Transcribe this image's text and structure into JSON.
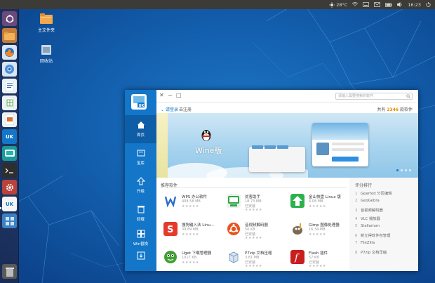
{
  "top_panel": {
    "weather": "28°C",
    "clock": "16:23"
  },
  "desktop": {
    "icons": [
      {
        "label": "主文件夹",
        "icon": "folder-icon"
      },
      {
        "label": "回收站",
        "icon": "trash-icon"
      }
    ]
  },
  "launcher": {
    "items": [
      "dash-home-icon",
      "files-icon",
      "firefox-icon",
      "chromium-icon",
      "writer-icon",
      "calc-icon",
      "impress-icon",
      "ubuntu-kylin-icon",
      "kylin-assistant-icon",
      "terminal-icon",
      "settings-icon",
      "software-center-icon",
      "workspace-icon",
      "trash-icon"
    ],
    "kylin_label": "UK"
  },
  "window": {
    "search_placeholder": "请输入需要搜索的软件",
    "login": "请登录",
    "register": "去注册",
    "count_prefix": "共有",
    "count": "2346",
    "count_suffix": "款软件",
    "nav": [
      {
        "label": "首页",
        "icon": "home-icon"
      },
      {
        "label": "宝库",
        "icon": "treasure-icon"
      },
      {
        "label": "升级",
        "icon": "upgrade-icon"
      },
      {
        "label": "卸载",
        "icon": "uninstall-icon"
      },
      {
        "label": "Win替换",
        "icon": "windows-grid-icon"
      },
      {
        "label": "",
        "icon": "download-task-icon"
      }
    ],
    "banner": {
      "title": "Wine版"
    },
    "recommend_title": "推荐软件",
    "apps": [
      {
        "name": "WPS 办公软件",
        "size": "408.58 MB",
        "stars": "★★★★★"
      },
      {
        "name": "优客助手",
        "size": "18.73 MB",
        "state": "已安装",
        "stars": "★★★★★"
      },
      {
        "name": "金山快盘 Linux 版",
        "size": "6.08 MB",
        "stars": "★★★★★"
      },
      {
        "name": "搜狗输入法 Linu...",
        "size": "39.89 MB",
        "stars": "★★★★★"
      },
      {
        "name": "音视频解码器",
        "size": "50 KB",
        "state": "已安装",
        "stars": "★★★★★"
      },
      {
        "name": "Gimp 图像处理器",
        "size": "16.34 MB",
        "stars": "★★★★★"
      },
      {
        "name": "Uget 下载管理器",
        "size": "1017 KB",
        "stars": "★★★★★"
      },
      {
        "name": "P7zip 文档压缩",
        "size": "3.81 MB",
        "state": "已安装",
        "stars": "★★★★★"
      },
      {
        "name": "Flash 插件",
        "size": "57 KB",
        "state": "已安装",
        "stars": "★★★★★"
      }
    ],
    "ranking_title": "评分排行",
    "ranking": [
      "Gparted 分区编辑",
      "GeoGebra",
      "音视频解码器",
      "VLC 播放器",
      "Stellarium",
      "新立得软件包管理",
      "FileZilla",
      "P7zip 文档压缩"
    ]
  }
}
